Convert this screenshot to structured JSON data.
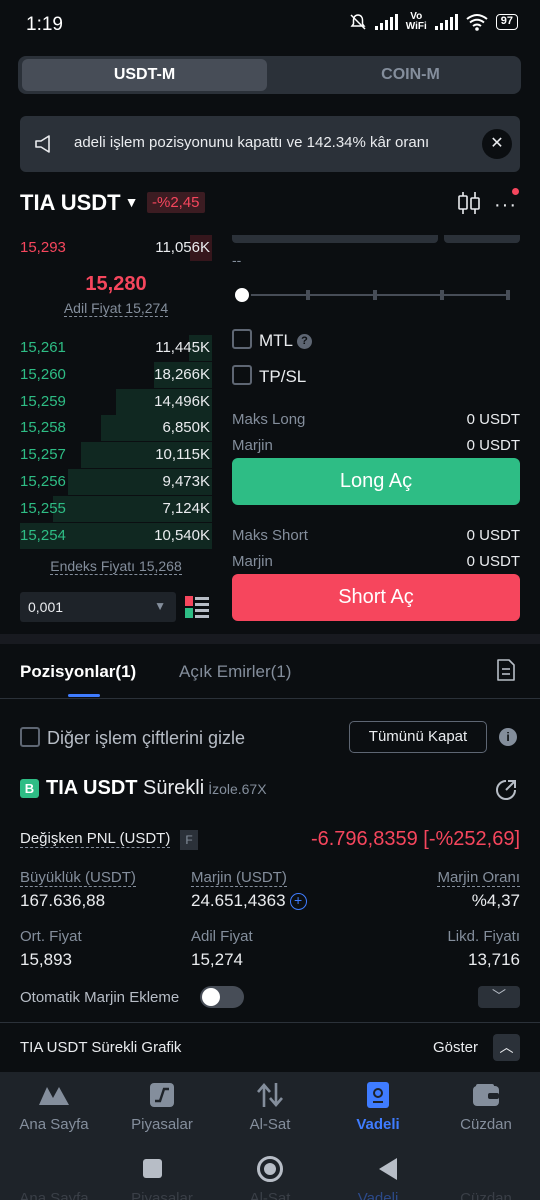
{
  "status": {
    "time": "1:19",
    "vowifi": "Vo\nWiFi",
    "battery": "97"
  },
  "segment": {
    "active": "USDT-M",
    "inactive": "COIN-M"
  },
  "banner": {
    "text": "adeli işlem pozisyonunu kapattı ve 142.34% kâr oranı"
  },
  "pair": {
    "symbol": "TIA USDT",
    "change": "-%2,45"
  },
  "orderbook": {
    "ask": {
      "price": "15,293",
      "qty": "11,056K"
    },
    "mid_price": "15,280",
    "fair_price": "Adil Fiyat 15,274",
    "bids": [
      {
        "price": "15,261",
        "qty": "11,445K",
        "depth": 0.12
      },
      {
        "price": "15,260",
        "qty": "18,266K",
        "depth": 0.3
      },
      {
        "price": "15,259",
        "qty": "14,496K",
        "depth": 0.5
      },
      {
        "price": "15,258",
        "qty": "6,850K",
        "depth": 0.58
      },
      {
        "price": "15,257",
        "qty": "10,115K",
        "depth": 0.68
      },
      {
        "price": "15,256",
        "qty": "9,473K",
        "depth": 0.75
      },
      {
        "price": "15,255",
        "qty": "7,124K",
        "depth": 0.83
      },
      {
        "price": "15,254",
        "qty": "10,540K",
        "depth": 1.0
      }
    ],
    "index_price": "Endeks Fiyatı 15,268",
    "precision": "0,001"
  },
  "trade": {
    "dashes": "--",
    "mtl": "MTL",
    "tpsl": "TP/SL",
    "max_long_label": "Maks Long",
    "max_long_value": "0 USDT",
    "margin_label": "Marjin",
    "margin_long_value": "0 USDT",
    "long_button": "Long Aç",
    "max_short_label": "Maks Short",
    "max_short_value": "0 USDT",
    "margin_short_value": "0 USDT",
    "short_button": "Short Aç"
  },
  "tabs": {
    "positions": "Pozisyonlar(1)",
    "orders": "Açık Emirler(1)"
  },
  "filters": {
    "hide_pairs": "Diğer işlem çiftlerini gizle",
    "close_all": "Tümünü Kapat"
  },
  "position": {
    "badge": "B",
    "symbol": "TIA USDT",
    "type": "Sürekli",
    "mode": "İzole.67X",
    "pnl_label": "Değişken PNL (USDT)",
    "pnl_f": "F",
    "pnl_value": "-6.796,8359 [-%252,69]",
    "size_label": "Büyüklük (USDT)",
    "size_value": "167.636,88",
    "margin_label": "Marjin (USDT)",
    "margin_value": "24.651,4363",
    "margin_ratio_label": "Marjin Oranı",
    "margin_ratio_value": "%4,37",
    "entry_label": "Ort. Fiyat",
    "entry_value": "15,893",
    "fair_label": "Adil Fiyat",
    "fair_value": "15,274",
    "liq_label": "Likd. Fiyatı",
    "liq_value": "13,716",
    "auto_margin": "Otomatik Marjin Ekleme"
  },
  "chart_row": {
    "label": "TIA USDT Sürekli Grafik",
    "show": "Göster"
  },
  "nav": [
    {
      "label": "Ana Sayfa"
    },
    {
      "label": "Piyasalar"
    },
    {
      "label": "Al-Sat"
    },
    {
      "label": "Vadeli"
    },
    {
      "label": "Cüzdan"
    }
  ],
  "colors": {
    "green": "#2ebd85",
    "red": "#f6465d",
    "accent": "#3f7cff"
  }
}
